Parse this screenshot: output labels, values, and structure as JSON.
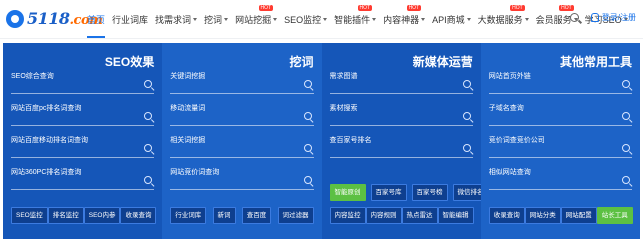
{
  "logo": {
    "text": "5118",
    "suffix": ".com"
  },
  "nav": [
    {
      "label": "首页",
      "active": true,
      "caret": false,
      "hot": false
    },
    {
      "label": "行业词库",
      "active": false,
      "caret": false,
      "hot": false
    },
    {
      "label": "找需求词",
      "active": false,
      "caret": true,
      "hot": false
    },
    {
      "label": "挖词",
      "active": false,
      "caret": true,
      "hot": false
    },
    {
      "label": "网站挖掘",
      "active": false,
      "caret": true,
      "hot": true
    },
    {
      "label": "SEO监控",
      "active": false,
      "caret": true,
      "hot": false
    },
    {
      "label": "智能插件",
      "active": false,
      "caret": true,
      "hot": true
    },
    {
      "label": "内容神器",
      "active": false,
      "caret": true,
      "hot": true
    },
    {
      "label": "API商城",
      "active": false,
      "caret": true,
      "hot": false
    },
    {
      "label": "大数据服务",
      "active": false,
      "caret": true,
      "hot": true
    },
    {
      "label": "会员服务",
      "active": false,
      "caret": true,
      "hot": true
    },
    {
      "label": "学习SEO",
      "active": false,
      "caret": true,
      "hot": false
    }
  ],
  "hot_badge": "HOT",
  "user": {
    "login": "登录/注册"
  },
  "columns": [
    {
      "title": "SEO效果",
      "fields": [
        "SEO综合查询",
        "网站百度pc排名词查询",
        "网站百度移动排名词查询",
        "网站360PC排名词查询"
      ],
      "buttons": [
        "SEO监控",
        "排名监控",
        "SEO内参",
        "收录查询"
      ]
    },
    {
      "title": "挖词",
      "fields": [
        "关键词挖掘",
        "移动流量词",
        "相关词挖掘",
        "网站竞价词查询"
      ],
      "buttons": [
        "行业词库",
        "新词",
        "查百度",
        "词过滤器"
      ]
    },
    {
      "title": "新媒体运营",
      "fields": [
        "需求图谱",
        "素材搜索",
        "查百家号排名"
      ],
      "mid_buttons": [
        "智能原创",
        "百家号库",
        "百家号榜",
        "微信排名"
      ],
      "buttons": [
        "内容监控",
        "内容规则",
        "热点雷达",
        "智能编辑"
      ]
    },
    {
      "title": "其他常用工具",
      "fields": [
        "网站首页外链",
        "子域名查询",
        "竞价词查竞价公司",
        "相似网站查询"
      ],
      "buttons": [
        "收录查询",
        "网站分类",
        "网站配置",
        "站长工具"
      ]
    }
  ]
}
